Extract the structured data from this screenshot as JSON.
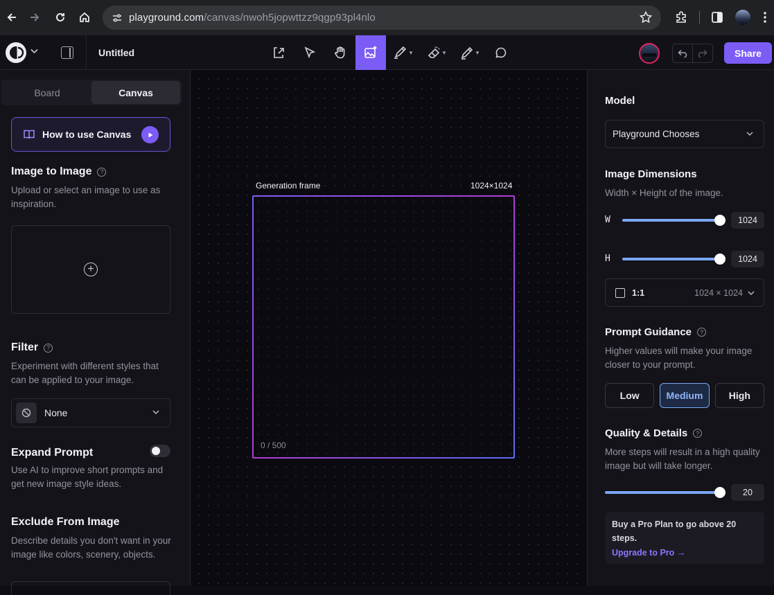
{
  "browser": {
    "url_host": "playground.com",
    "url_path": "/canvas/nwoh5jopwttzz9qgp93pl4nlo"
  },
  "app": {
    "doc_title": "Untitled",
    "share_label": "Share",
    "tools": [
      "import",
      "select",
      "pan",
      "generate",
      "draw",
      "erase",
      "edit",
      "comment"
    ],
    "active_tool": "generate",
    "colors": {
      "accent": "#7b5cf5",
      "slider": "#7aa7f5",
      "avatar_ring": "#e0245e"
    }
  },
  "left": {
    "tabs": [
      "Board",
      "Canvas"
    ],
    "active_tab": "Canvas",
    "howto_label": "How to use Canvas",
    "img2img": {
      "title": "Image to Image",
      "desc": "Upload or select an image to use as inspiration."
    },
    "filter": {
      "title": "Filter",
      "desc": "Experiment with different styles that can be applied to your image.",
      "value": "None"
    },
    "expand": {
      "title": "Expand Prompt",
      "desc": "Use AI to improve short prompts and get new image style ideas.",
      "enabled": false
    },
    "exclude": {
      "title": "Exclude From Image",
      "desc": "Describe details you don't want in your image like colors, scenery, objects."
    }
  },
  "canvas": {
    "frame_label": "Generation frame",
    "frame_size": "1024×1024",
    "prompt_counter": "0 / 500"
  },
  "right": {
    "model": {
      "title": "Model",
      "value": "Playground Chooses"
    },
    "dimensions": {
      "title": "Image Dimensions",
      "desc": "Width × Height of the image.",
      "w_label": "W",
      "w_value": "1024",
      "w_fraction": 1.0,
      "h_label": "H",
      "h_value": "1024",
      "h_fraction": 1.0,
      "ratio": "1:1",
      "ratio_dims": "1024 × 1024"
    },
    "guidance": {
      "title": "Prompt Guidance",
      "desc": "Higher values will make your image closer to your prompt.",
      "options": [
        "Low",
        "Medium",
        "High"
      ],
      "selected": "Medium"
    },
    "quality": {
      "title": "Quality & Details",
      "desc": "More steps will result in a high quality image but will take longer.",
      "value": "20",
      "fraction": 1.0
    },
    "pro": {
      "text": "Buy a Pro Plan to go above 20 steps.",
      "link": "Upgrade to Pro →"
    }
  }
}
